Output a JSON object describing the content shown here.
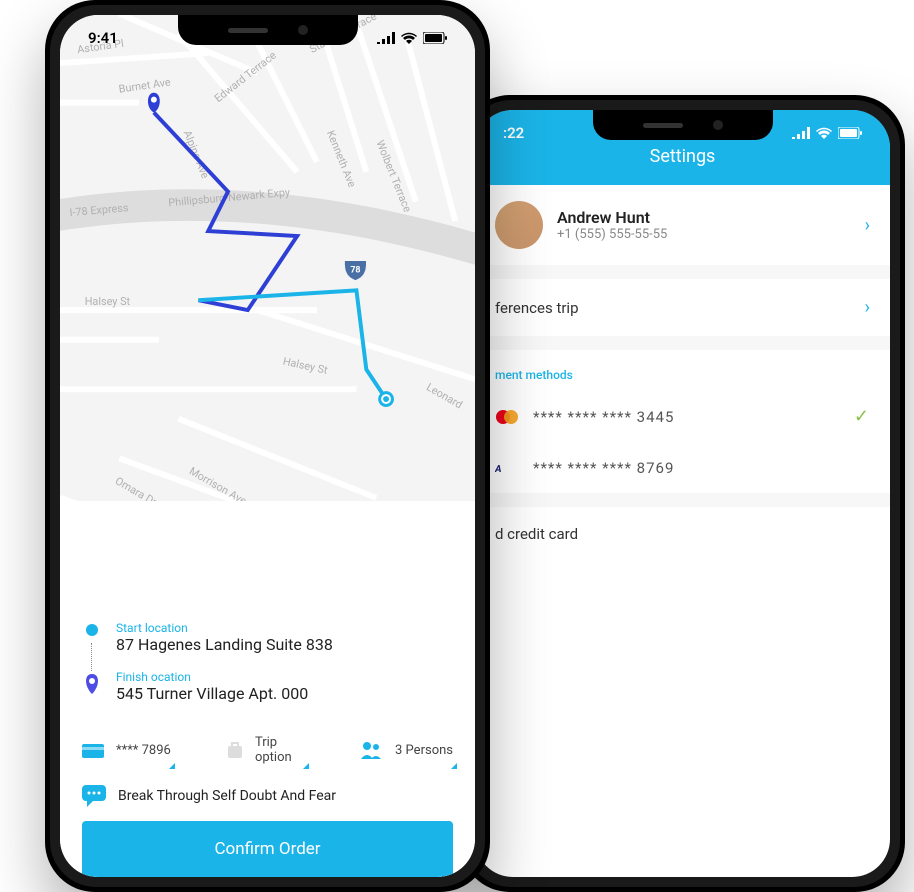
{
  "phone1": {
    "status": {
      "time": "9:41"
    },
    "start": {
      "label": "Start location",
      "value": "87 Hagenes Landing Suite 838"
    },
    "finish": {
      "label": "Finish ocation",
      "value": "545 Turner Village Apt. 000"
    },
    "options": {
      "card": "**** 7896",
      "trip": "Trip option",
      "persons": "3 Persons"
    },
    "note": "Break Through Self Doubt And Fear",
    "confirm": "Confirm Order",
    "map": {
      "streets": [
        "Astoria Pl",
        "Burnet Ave",
        "Alpine Ave",
        "Edward Terrace",
        "Stanley Terrace",
        "Kenneth Ave",
        "Wolbert Terrace",
        "I-78 Express",
        "Phillipsburg-Newark Expy",
        "Halsey St",
        "Halsey St",
        "Leonard",
        "Omara Dr",
        "Morrison Ave"
      ],
      "route_shield": "78"
    }
  },
  "phone2": {
    "status": {
      "time": ":22"
    },
    "header": "Settings",
    "profile": {
      "name": "Andrew Hunt",
      "phone": "+1 (555) 555-55-55"
    },
    "preferences": "ferences trip",
    "payment_label": "ment methods",
    "cards": [
      {
        "num": "**** **** **** 3445",
        "active": true
      },
      {
        "num": "**** **** **** 8769",
        "active": false
      }
    ],
    "add_card": "d credit card"
  }
}
